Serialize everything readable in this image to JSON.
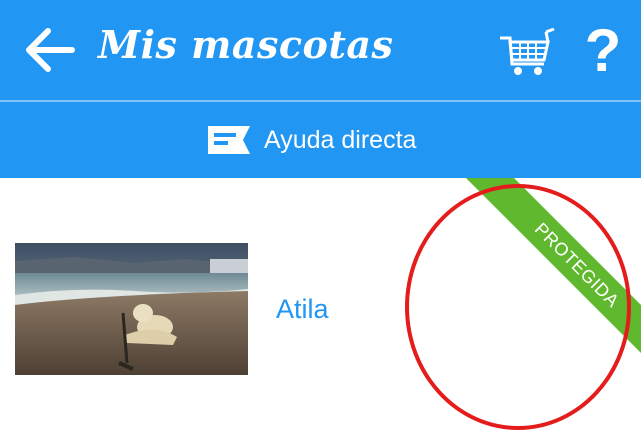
{
  "app_bar": {
    "title": "Mis mascotas",
    "help_label": "?",
    "help_direct_label": "Ayuda directa",
    "color": "#2196f3"
  },
  "pets": [
    {
      "name": "Atila",
      "status_badge": "PROTEGIDA"
    }
  ],
  "colors": {
    "badge": "#5fb82e",
    "highlight_circle": "#e41c1c",
    "link": "#2196f3"
  },
  "icons": [
    "back-arrow-icon",
    "shopping-cart-icon",
    "message-icon"
  ]
}
